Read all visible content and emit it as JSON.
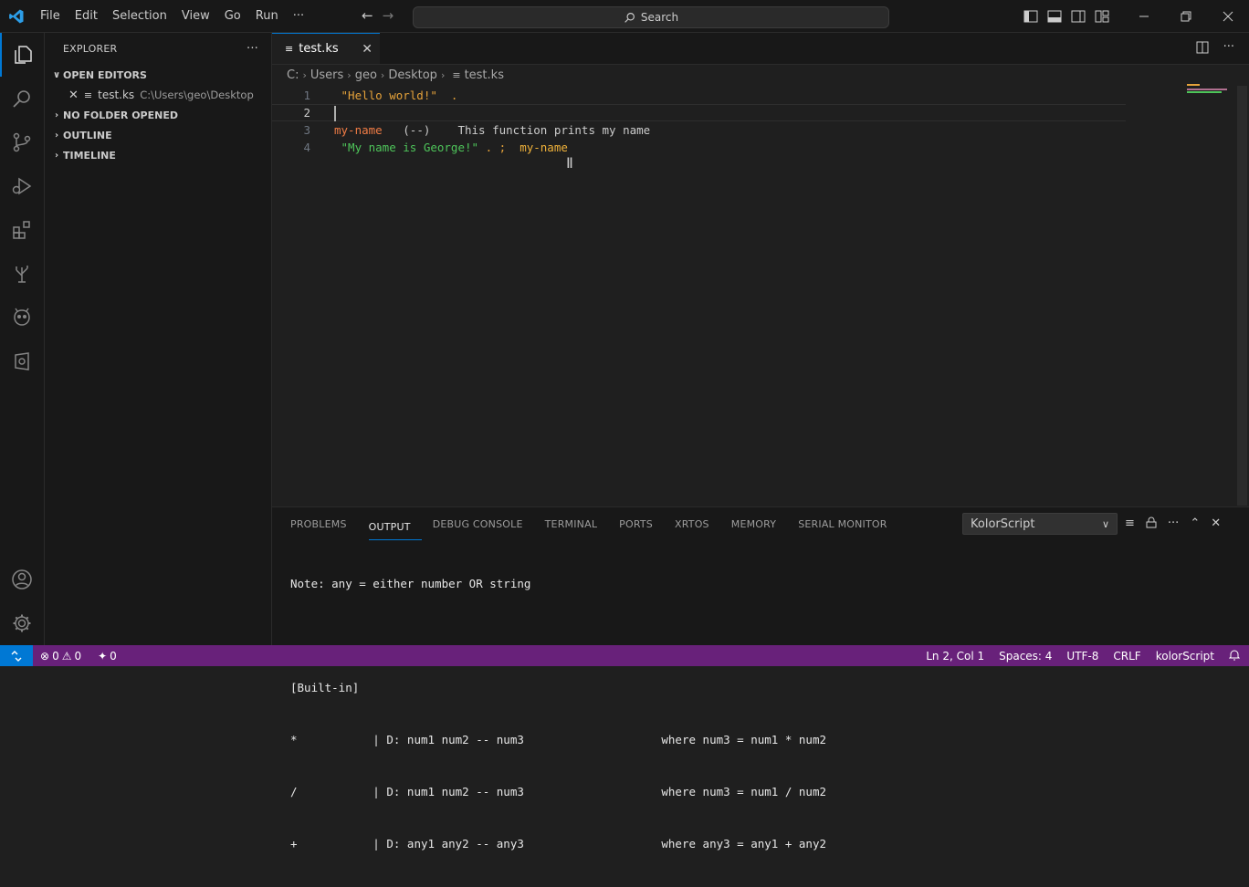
{
  "titlebar": {
    "menu": [
      "File",
      "Edit",
      "Selection",
      "View",
      "Go",
      "Run",
      "···"
    ],
    "search_label": "Search"
  },
  "sidebar": {
    "title": "EXPLORER",
    "more": "···",
    "sections": [
      "OPEN EDITORS",
      "NO FOLDER OPENED",
      "OUTLINE",
      "TIMELINE"
    ],
    "open_file": {
      "name": "test.ks",
      "path": "C:\\Users\\geo\\Desktop"
    }
  },
  "editor": {
    "tab": "test.ks",
    "breadcrumb": [
      "C:",
      "Users",
      "geo",
      "Desktop",
      "test.ks"
    ],
    "line_numbers": [
      "1",
      "2",
      "3",
      "4"
    ],
    "lines": [
      [
        {
          "t": " \"Hello world!\"  .",
          "c": "#e5a23a"
        }
      ],
      [],
      [
        {
          "t": "my-name",
          "c": "#f07c45"
        },
        {
          "t": "   (--)    This function prints my name",
          "c": "#cccccc"
        }
      ],
      [
        {
          "t": " \"My name is George!\"",
          "c": "#4ec55a"
        },
        {
          "t": " . ;  ",
          "c": "#e5a23a"
        },
        {
          "t": "my-name",
          "c": "#f0b23a"
        }
      ]
    ]
  },
  "panel": {
    "tabs": [
      "PROBLEMS",
      "OUTPUT",
      "DEBUG CONSOLE",
      "TERMINAL",
      "PORTS",
      "XRTOS",
      "MEMORY",
      "SERIAL MONITOR"
    ],
    "active_tab": "OUTPUT",
    "channel": "KolorScript",
    "output": [
      "Note: any = either number OR string",
      "",
      "[Built-in]",
      "*           | D: num1 num2 -- num3                    where num3 = num1 * num2",
      "/           | D: num1 num2 -- num3                    where num3 = num1 / num2",
      "+           | D: any1 any2 -- any3                    where any3 = any1 + any2"
    ]
  },
  "statusbar": {
    "errors": "0",
    "warnings": "0",
    "ports": "0",
    "position": "Ln 2, Col 1",
    "spaces": "Spaces: 4",
    "encoding": "UTF-8",
    "eol": "CRLF",
    "language": "kolorScript"
  },
  "colors": {
    "accent": "#0078d4",
    "status_bar": "#68217a"
  }
}
